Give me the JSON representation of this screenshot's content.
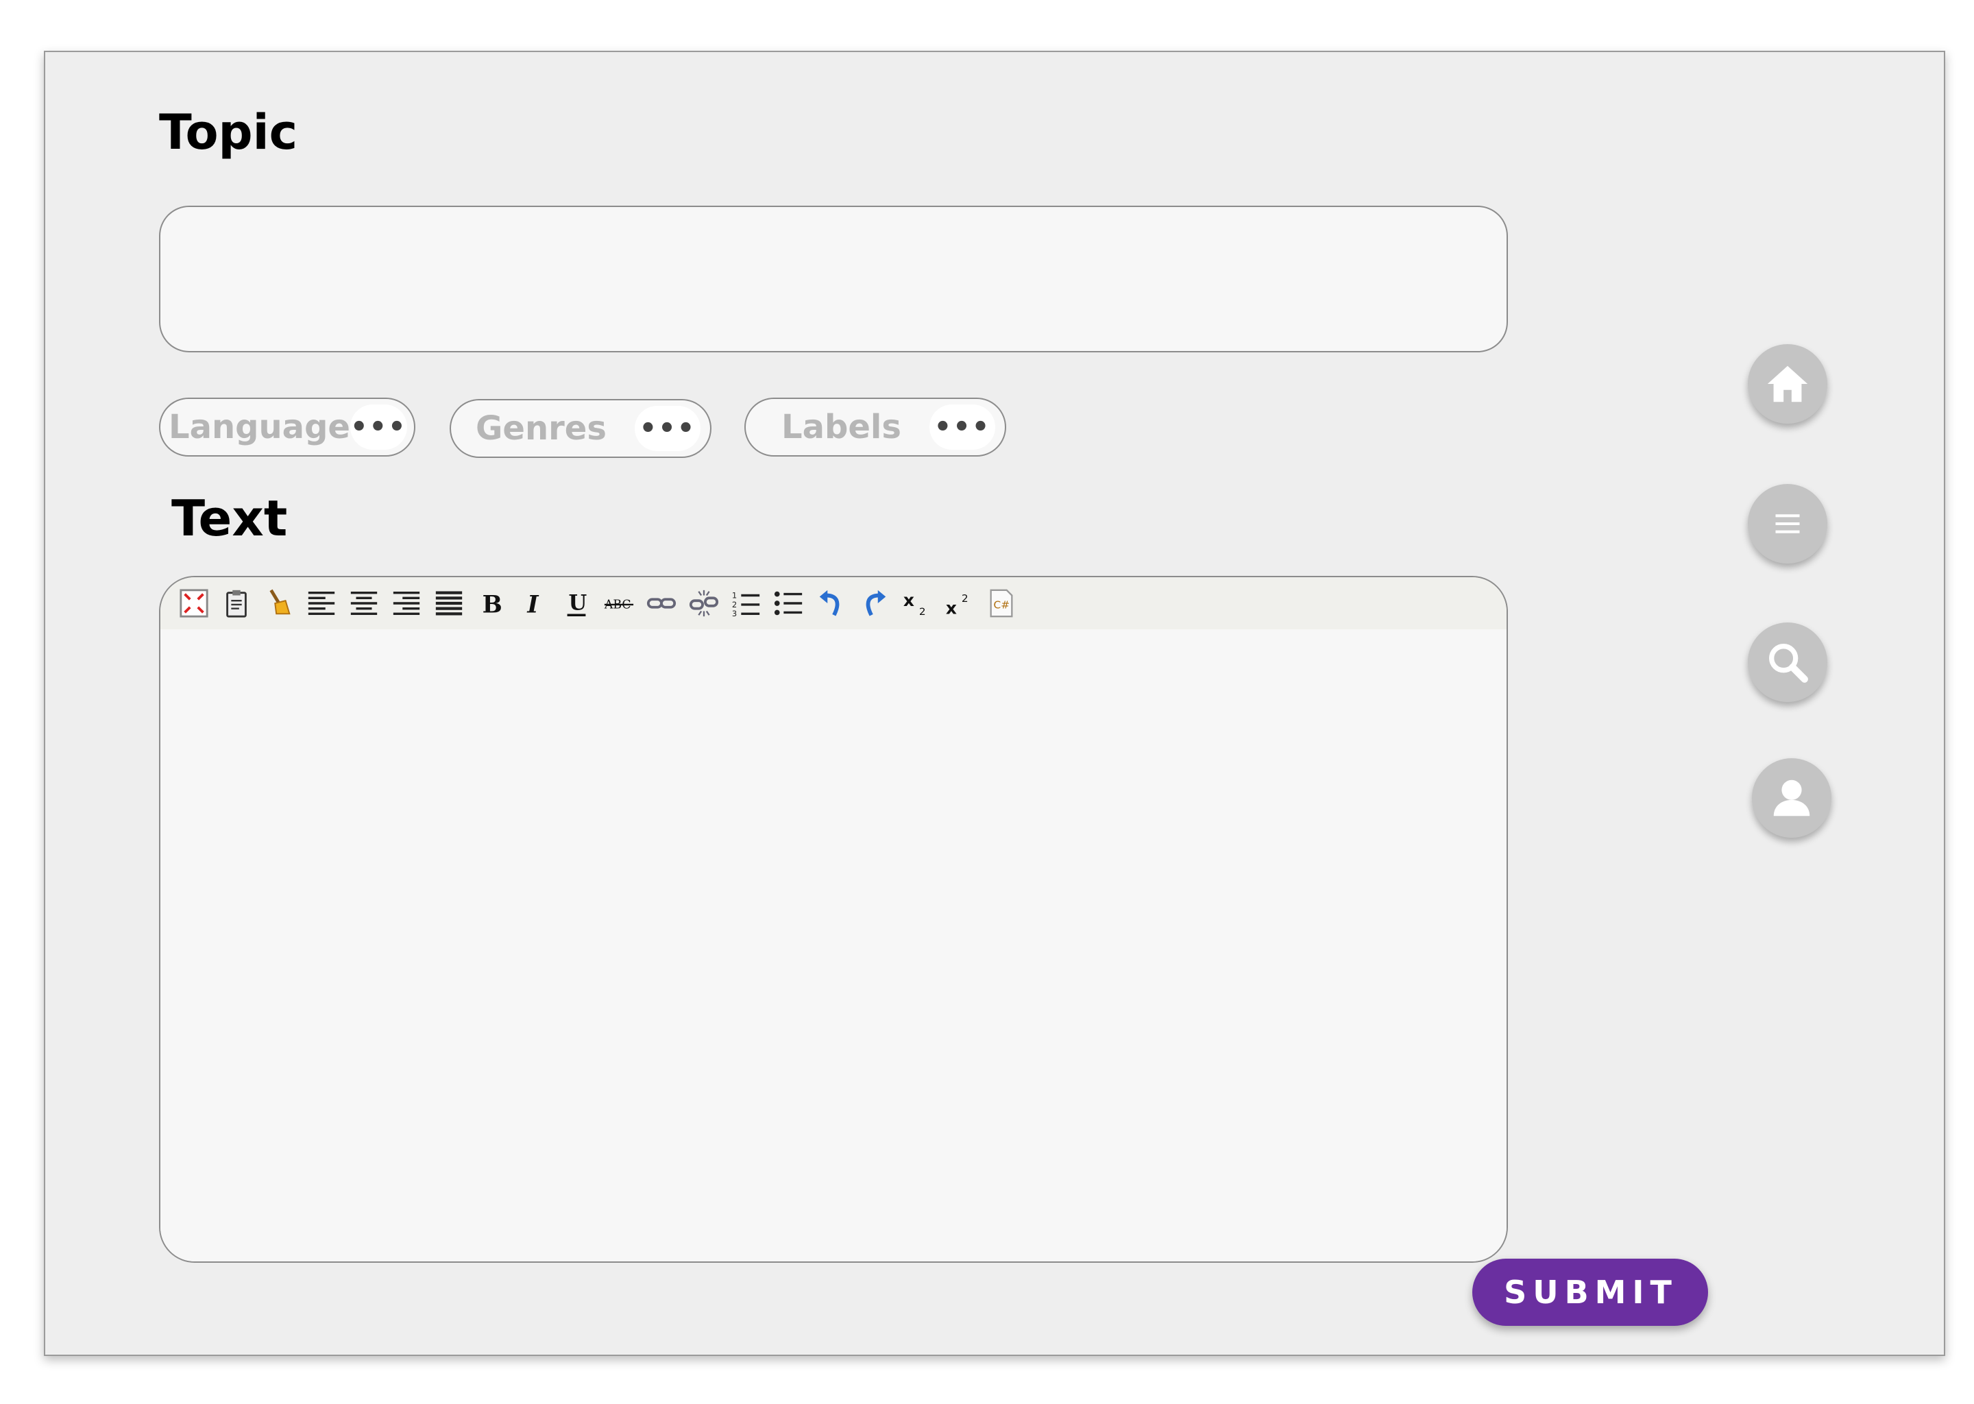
{
  "topic": {
    "heading": "Topic",
    "value": "",
    "placeholder": ""
  },
  "filters": {
    "language_label": "Language",
    "genres_label": "Genres",
    "labels_label": "Labels",
    "more_glyph": "•••"
  },
  "text_section": {
    "heading": "Text",
    "toolbar_tools": [
      "fullscreen-icon",
      "paste-icon",
      "clean-formatting-icon",
      "align-left-icon",
      "align-center-icon",
      "align-right-icon",
      "align-justify-icon",
      "bold-icon",
      "italic-icon",
      "underline-icon",
      "strikethrough-icon",
      "link-icon",
      "unlink-icon",
      "numbered-list-icon",
      "bulleted-list-icon",
      "undo-icon",
      "redo-icon",
      "subscript-icon",
      "superscript-icon",
      "source-code-icon"
    ],
    "body": ""
  },
  "sidebar_nav": [
    "home-icon",
    "menu-icon",
    "search-icon",
    "user-icon"
  ],
  "submit": {
    "label": "SUBMIT",
    "color": "#6a2fa0"
  }
}
